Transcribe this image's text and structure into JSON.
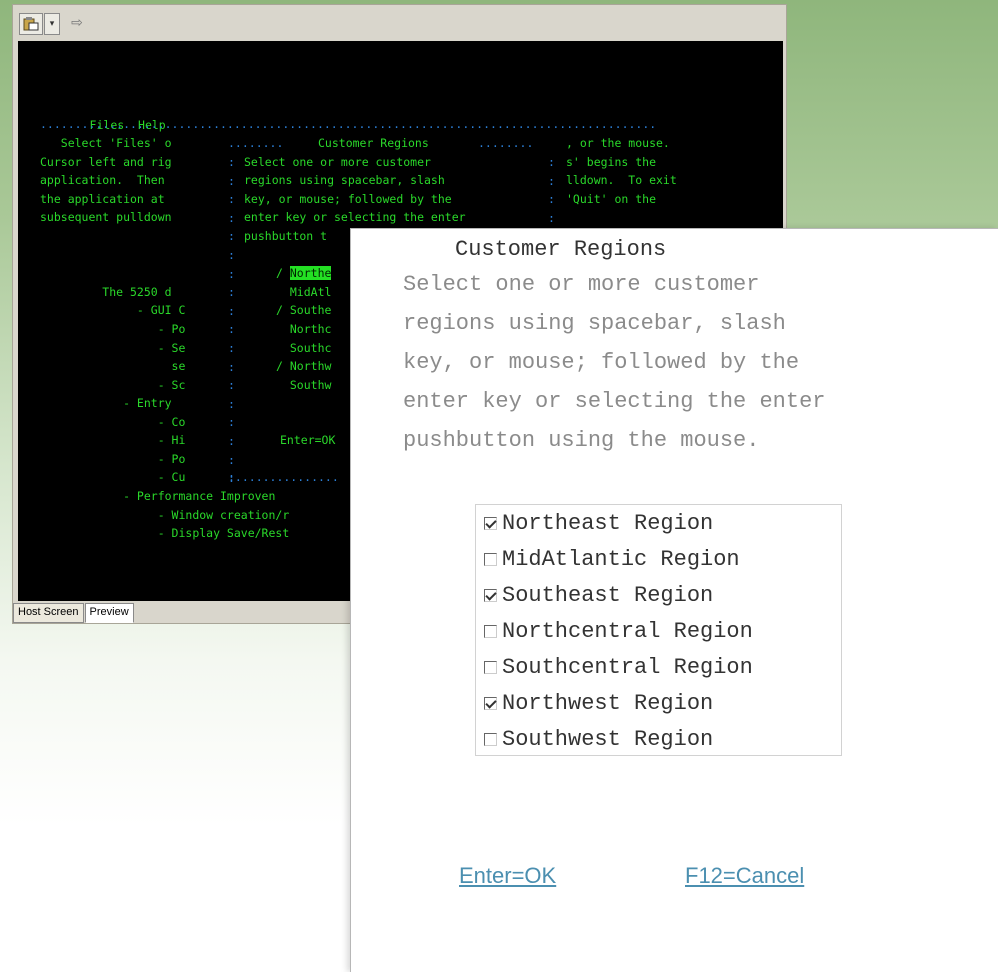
{
  "toolbar": {
    "paste_icon": "paste-icon",
    "dropdown_icon": "chevron-down-icon",
    "export_icon": "export-icon"
  },
  "terminal": {
    "menu": [
      "Files",
      "Help"
    ],
    "lines": [
      "   Select 'Files' o",
      "Cursor left and rig",
      "application.  Then",
      "the application at",
      "subsequent pulldown",
      "         The 5250 d",
      "              - GUI C",
      "                 - Po",
      "                 - Se",
      "                   se",
      "                 - Sc",
      "            - Entry",
      "                 - Co",
      "                 - Hi",
      "                 - Po",
      "                 - Cu",
      "            - Performance Improven",
      "                 - Window creation/r",
      "                 - Display Save/Rest"
    ],
    "dialog_title": "Customer Regions",
    "dialog_lines": [
      "Select one or more customer",
      "regions using spacebar, slash",
      "key, or mouse; followed by the",
      "enter key or selecting the enter",
      "pushbutton t"
    ],
    "right_lines": [
      ", or the mouse.",
      "s' begins the",
      "lldown.  To exit",
      "'Quit' on the"
    ],
    "regions": [
      {
        "mark": "/",
        "label": "Northe",
        "highlight": true
      },
      {
        "mark": " ",
        "label": "MidAtl",
        "highlight": false
      },
      {
        "mark": "/",
        "label": "Southe",
        "highlight": false
      },
      {
        "mark": " ",
        "label": "Northc",
        "highlight": false
      },
      {
        "mark": " ",
        "label": "Southc",
        "highlight": false
      },
      {
        "mark": "/",
        "label": "Northw",
        "highlight": false
      },
      {
        "mark": " ",
        "label": "Southw",
        "highlight": false
      }
    ],
    "enter_label": "Enter=OK"
  },
  "tabs": [
    {
      "label": "Host Screen",
      "active": false
    },
    {
      "label": "Preview",
      "active": true
    }
  ],
  "preview": {
    "title": "Customer Regions",
    "instructions": [
      "Select one or more customer",
      "regions using spacebar, slash",
      "key, or mouse; followed by the",
      "enter key or selecting the enter",
      "pushbutton using the mouse."
    ],
    "regions": [
      {
        "label": "Northeast Region",
        "checked": true
      },
      {
        "label": "MidAtlantic Region",
        "checked": false
      },
      {
        "label": "Southeast Region",
        "checked": true
      },
      {
        "label": "Northcentral Region",
        "checked": false
      },
      {
        "label": "Southcentral Region",
        "checked": false
      },
      {
        "label": "Northwest Region",
        "checked": true
      },
      {
        "label": "Southwest Region",
        "checked": false
      }
    ],
    "ok_label": "Enter=OK",
    "cancel_label": "F12=Cancel"
  },
  "colors": {
    "terminal_text": "#2ad82a",
    "terminal_bg": "#000000",
    "separator": "#2c7fd6",
    "link": "#4b8fb0"
  }
}
